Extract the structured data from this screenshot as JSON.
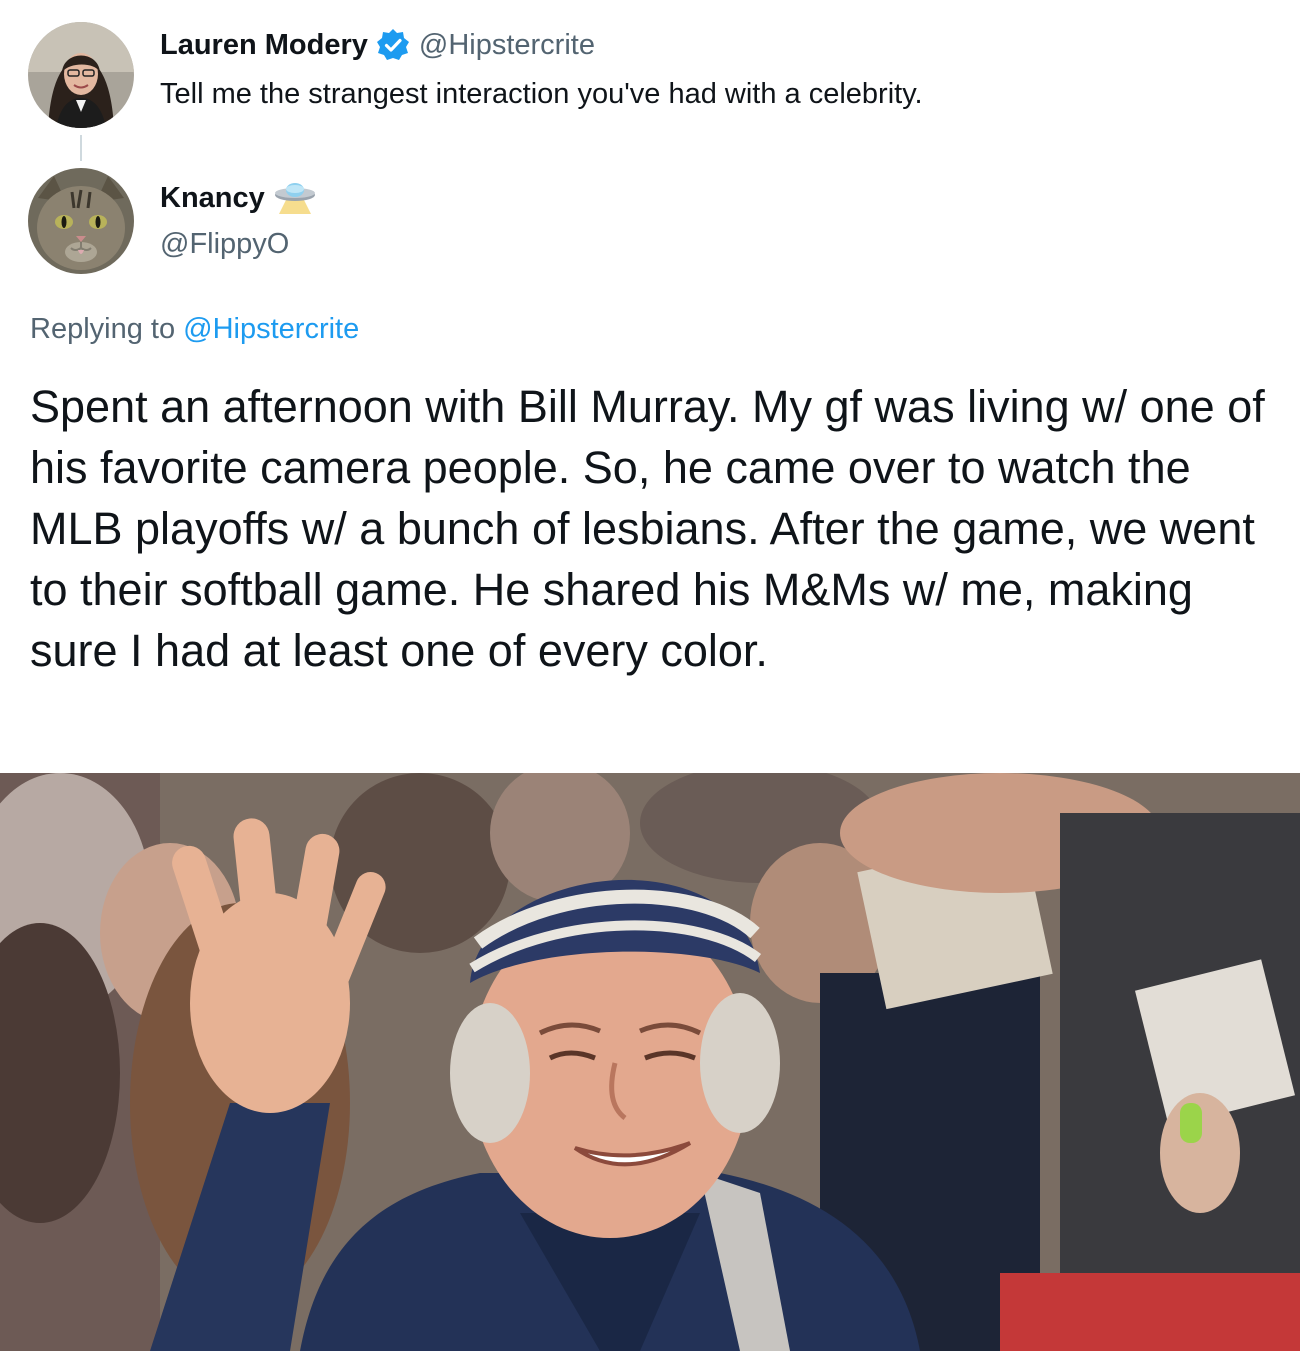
{
  "parent_tweet": {
    "display_name": "Lauren Modery",
    "handle": "@Hipstercrite",
    "verified_icon": "verified-badge-icon",
    "text": "Tell me the strangest interaction you've had with a celebrity."
  },
  "reply_tweet": {
    "display_name": "Knancy",
    "name_emoji": "ufo-icon",
    "handle": "@FlippyO",
    "replying_label": "Replying to",
    "replying_handle": "@Hipstercrite",
    "text": "Spent an afternoon with Bill Murray. My gf was living w/ one of his favorite camera people. So, he came over to watch the MLB playoffs w/ a bunch of lesbians. After the game, we went to their softball game. He shared his M&Ms w/ me, making sure I had at least one of every color."
  },
  "colors": {
    "text_primary": "#0f1419",
    "text_secondary": "#536471",
    "link": "#1d9bf0",
    "thread_line": "#cfd9de"
  }
}
